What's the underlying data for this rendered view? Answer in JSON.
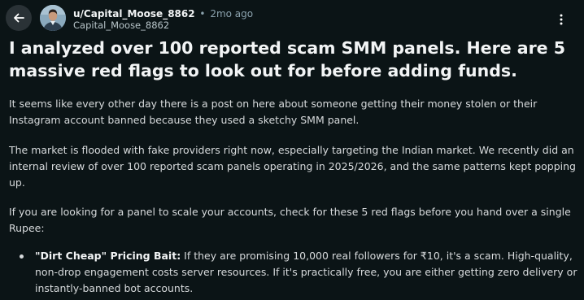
{
  "header": {
    "back_icon": "arrow-left-icon",
    "username": "u/Capital_Moose_8862",
    "separator": "•",
    "time_ago": "2mo ago",
    "display_name": "Capital_Moose_8862",
    "more_icon": "ellipsis-vertical-icon"
  },
  "post": {
    "title": "I analyzed over 100 reported scam SMM panels. Here are 5 massive red flags to look out for before adding funds.",
    "paragraphs": [
      "It seems like every other day there is a post on here about someone getting their money stolen or their Instagram account banned because they used a sketchy SMM panel.",
      "The market is flooded with fake providers right now, especially targeting the Indian market. We recently did an internal review of over 100 reported scam panels operating in 2025/2026, and the same patterns kept popping up.",
      "If you are looking for a panel to scale your accounts, check for these 5 red flags before you hand over a single Rupee:"
    ],
    "list_items": [
      {
        "title": "\"Dirt Cheap\" Pricing Bait:",
        "text": " If they are promising 10,000 real followers for ₹10, it's a scam. High-quality, non-drop engagement costs server resources. If it's practically free, you are either getting zero delivery or instantly-banned bot accounts."
      }
    ]
  },
  "colors": {
    "background": "#0b1416",
    "text": "#d7dadc",
    "heading": "#f2f4f5",
    "muted": "#8ba2ad",
    "button_bg": "#2a3236"
  }
}
